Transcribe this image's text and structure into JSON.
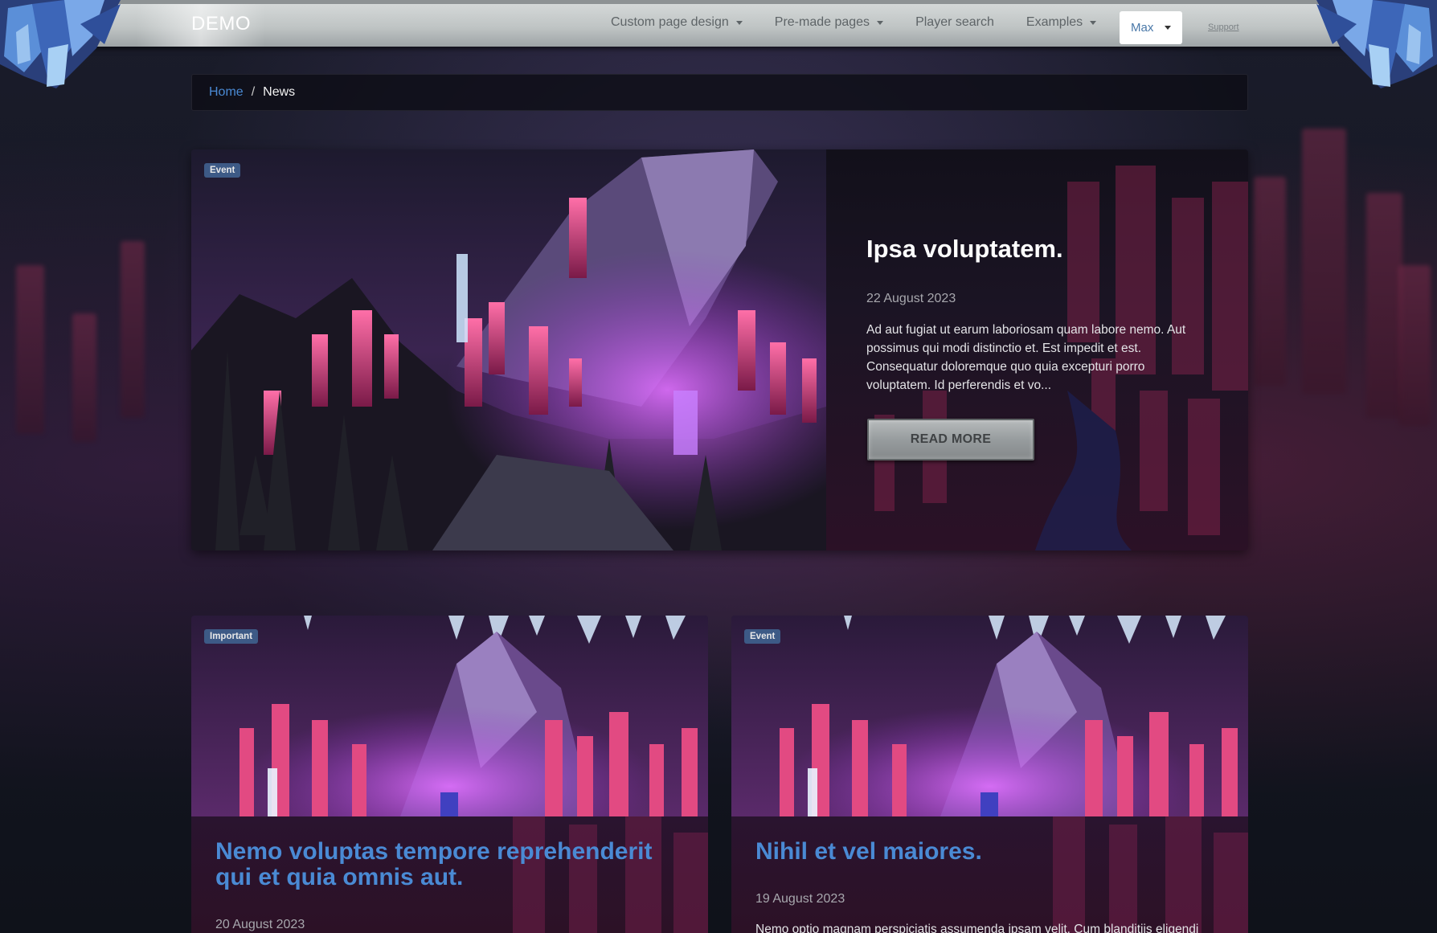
{
  "nav": {
    "brand": "DEMO",
    "links": [
      {
        "label": "Custom page design",
        "dropdown": true
      },
      {
        "label": "Pre-made pages",
        "dropdown": true
      },
      {
        "label": "Player search",
        "dropdown": false
      },
      {
        "label": "Examples",
        "dropdown": true
      }
    ],
    "user_label": "Max",
    "support_label": "Support"
  },
  "breadcrumb": {
    "home": "Home",
    "separator": "/",
    "current": "News"
  },
  "featured": {
    "badge": "Event",
    "title": "Ipsa voluptatem.",
    "date": "22 August 2023",
    "excerpt": "Ad aut fugiat ut earum laboriosam quam labore nemo. Aut possimus qui modi distinctio et. Est impedit et est. Consequatur doloremque quo quia excepturi porro voluptatem. Id perferendis et vo...",
    "read_more": "READ MORE"
  },
  "cards": [
    {
      "badge": "Important",
      "title": "Nemo voluptas tempore reprehenderit qui et quia omnis aut.",
      "date": "20 August 2023",
      "excerpt": ""
    },
    {
      "badge": "Event",
      "title": "Nihil et vel maiores.",
      "date": "19 August 2023",
      "excerpt": "Nemo optio magnam perspiciatis assumenda ipsam velit. Cum blanditiis eligendi"
    }
  ],
  "colors": {
    "accent_link": "#4a8ad4",
    "badge": "#3d5a86",
    "nav_bg": "#c6caca",
    "page_bg": "#11141c"
  }
}
